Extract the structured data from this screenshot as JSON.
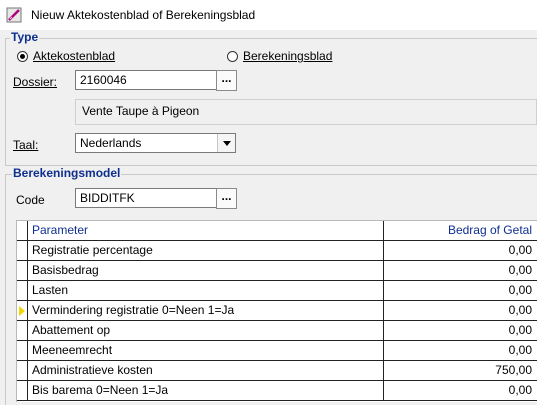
{
  "window": {
    "title": "Nieuw Aktekostenblad of Berekeningsblad"
  },
  "type_group": {
    "title": "Type",
    "options": [
      {
        "label": "Aktekostenblad",
        "checked": true
      },
      {
        "label": "Berekeningsblad",
        "checked": false
      }
    ]
  },
  "dossier": {
    "label": "Dossier:",
    "value": "2160046",
    "button": "...",
    "description": "Vente Taupe à Pigeon"
  },
  "taal": {
    "label": "Taal:",
    "value": "Nederlands"
  },
  "model_group": {
    "title": "Berekeningsmodel",
    "code_label": "Code",
    "code_value": "BIDDITFK",
    "button": "..."
  },
  "grid": {
    "columns": [
      "Parameter",
      "Bedrag of Getal"
    ],
    "rows": [
      {
        "parameter": "Registratie percentage",
        "value": "0,00",
        "current": false
      },
      {
        "parameter": "Basisbedrag",
        "value": "0,00",
        "current": false
      },
      {
        "parameter": "Lasten",
        "value": "0,00",
        "current": false
      },
      {
        "parameter": "Vermindering registratie 0=Neen 1=Ja",
        "value": "0,00",
        "current": true
      },
      {
        "parameter": "Abattement op",
        "value": "0,00",
        "current": false
      },
      {
        "parameter": "Meeneemrecht",
        "value": "0,00",
        "current": false
      },
      {
        "parameter": "Administratieve kosten",
        "value": "750,00",
        "current": false
      },
      {
        "parameter": "Bis barema 0=Neen 1=Ja",
        "value": "0,00",
        "current": false
      }
    ]
  }
}
